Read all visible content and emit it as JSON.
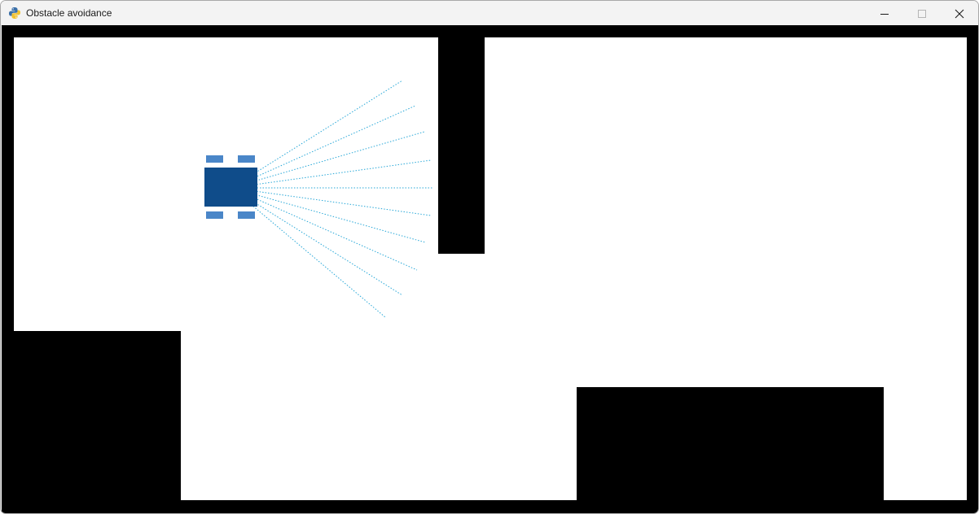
{
  "window": {
    "title": "Obstacle avoidance",
    "icon": "python-snake-icon",
    "controls": [
      "minimize-icon",
      "maximize-icon",
      "close-icon"
    ]
  },
  "scene": {
    "background_color": "#000000",
    "floor_color": "#ffffff",
    "robot": {
      "body_color": "#0f4c8a",
      "wheel_color": "#4a86c8",
      "heading": "right"
    },
    "sensor": {
      "ray_color": "#29a8d8",
      "ray_count": 9,
      "style": "dotted"
    }
  }
}
